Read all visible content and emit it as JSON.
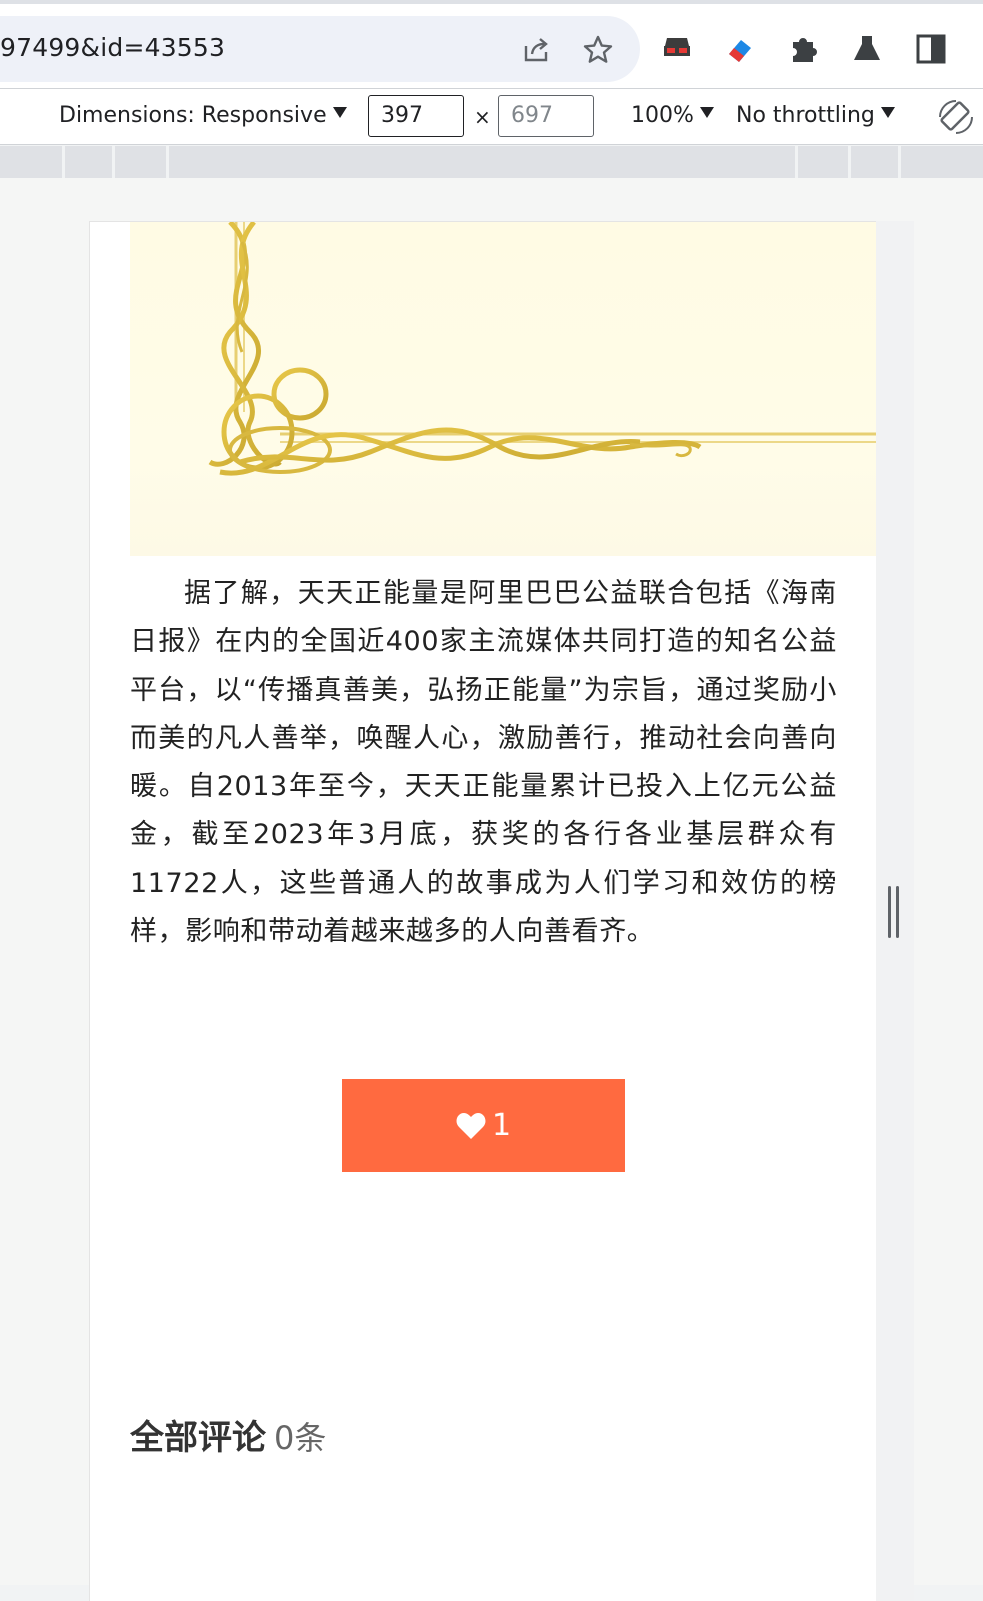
{
  "browser": {
    "url": "97499&id=43553"
  },
  "devtools": {
    "dimensions_label": "Dimensions: Responsive",
    "width_value": "397",
    "height_value": "697",
    "times": "×",
    "zoom": "100%",
    "throttling": "No throttling"
  },
  "article": {
    "paragraph": "据了解，天天正能量是阿里巴巴公益联合包括《海南日报》在内的全国近400家主流媒体共同打造的知名公益平台，以“传播真善美，弘扬正能量”为宗旨，通过奖励小而美的凡人善举，唤醒人心，激励善行，推动社会向善向暖。自2013年至今，天天正能量累计已投入上亿元公益金，截至2023年3月底，获奖的各行各业基层群众有11722人，这些普通人的故事成为人们学习和效仿的榜样，影响和带动着越来越多的人向善看齐。"
  },
  "like": {
    "count": "1",
    "color": "#ff6a40"
  },
  "comments": {
    "title": "全部评论",
    "count": "0条"
  }
}
